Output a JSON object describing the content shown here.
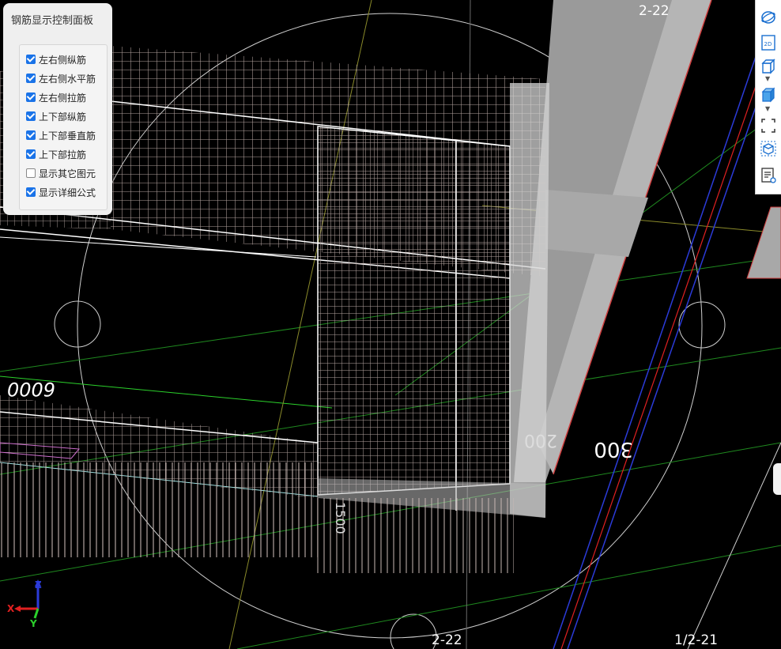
{
  "panel": {
    "title": "钢筋显示控制面板",
    "options": [
      {
        "label": "左右侧纵筋",
        "checked": true
      },
      {
        "label": "左右侧水平筋",
        "checked": true
      },
      {
        "label": "左右侧拉筋",
        "checked": true
      },
      {
        "label": "上下部纵筋",
        "checked": true
      },
      {
        "label": "上下部垂直筋",
        "checked": true
      },
      {
        "label": "上下部拉筋",
        "checked": true
      },
      {
        "label": "显示其它图元",
        "checked": false
      },
      {
        "label": "显示详细公式",
        "checked": true
      }
    ]
  },
  "toolbar": {
    "icons": [
      "orbit-icon",
      "2d-view-icon",
      "3d-cube-icon",
      "solid-cube-icon",
      "fit-view-icon",
      "box-select-icon",
      "layer-display-icon"
    ],
    "view2d_label": "2D"
  },
  "axis_labels": {
    "top": "2-22",
    "bottom_center": "2-22",
    "bottom_right": "1/2-21"
  },
  "dimensions": {
    "d6000": "6000",
    "d300": "300",
    "d200": "200",
    "d1500": "1500"
  },
  "axes_gizmo": {
    "x": "X",
    "y": "Y",
    "z": "Z"
  },
  "colors": {
    "checkbox": "#1a73e8",
    "rebar": "#c8b8b4",
    "concrete": "#8f8f8f",
    "grid_green": "#2aa52a",
    "axis_blue": "#2b3bd9",
    "axis_red": "#e02020"
  }
}
